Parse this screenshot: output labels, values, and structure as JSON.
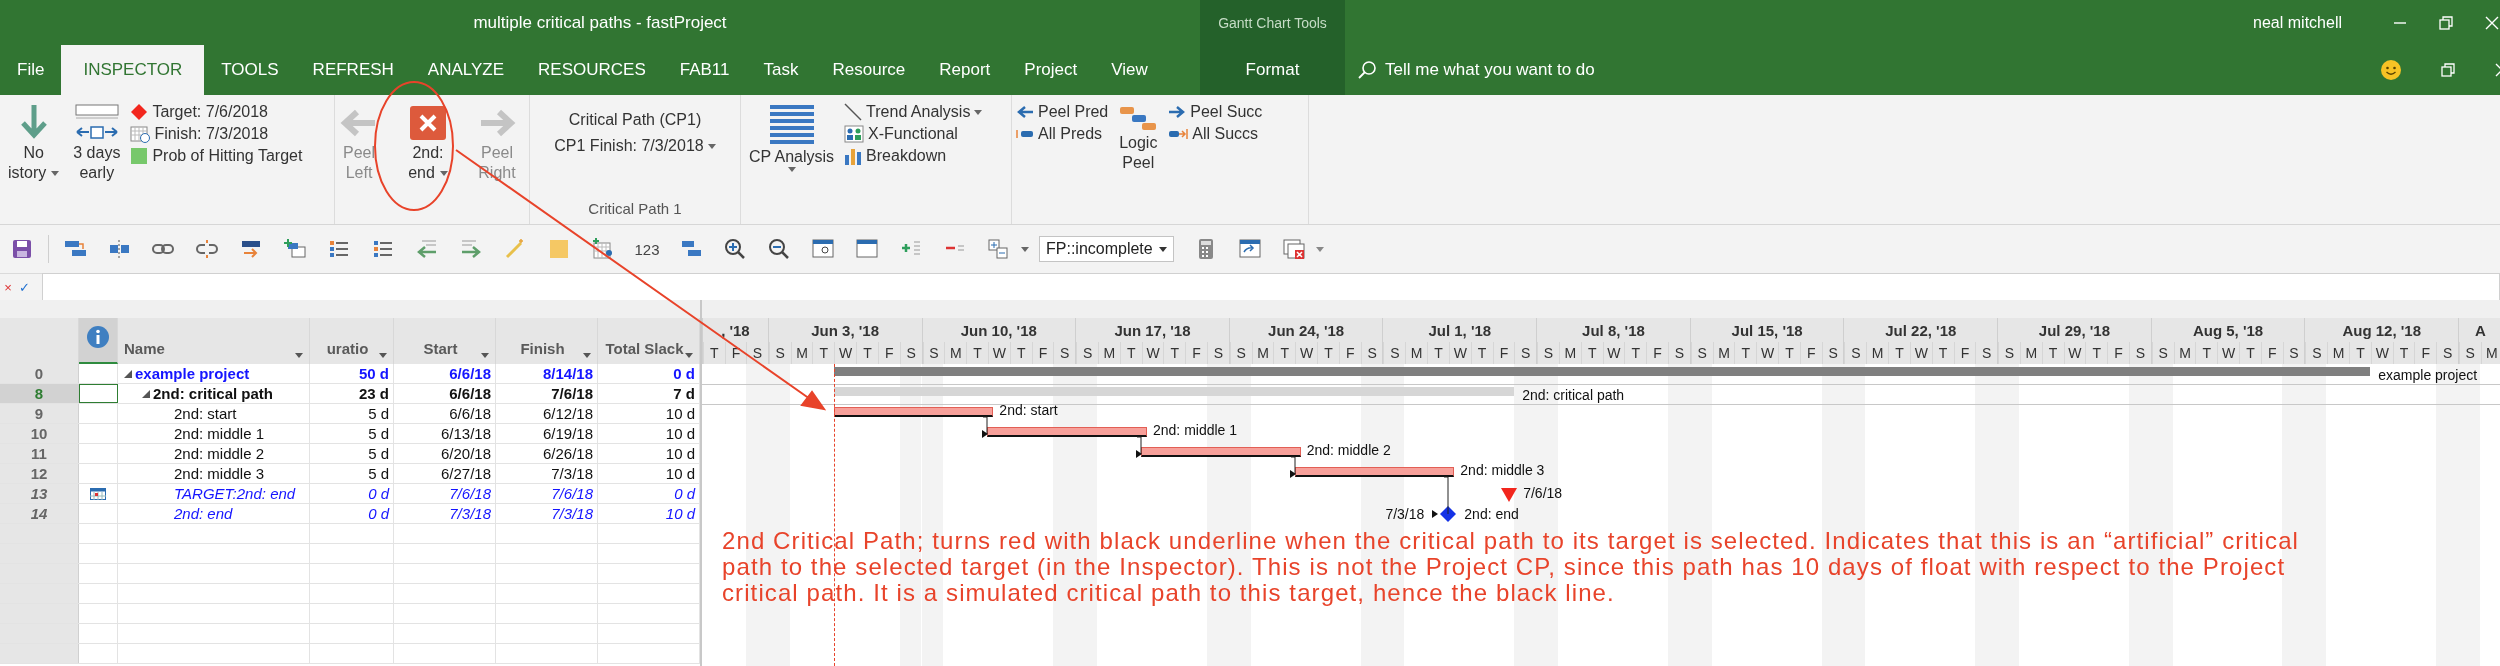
{
  "window": {
    "title": "multiple critical paths  -  fastProject",
    "context_group": "Gantt Chart Tools",
    "user": "neal mitchell"
  },
  "tabs": [
    {
      "label": "File",
      "kind": "standard",
      "selected": false
    },
    {
      "label": "INSPECTOR",
      "kind": "standard",
      "selected": true
    },
    {
      "label": "TOOLS",
      "kind": "standard",
      "selected": false
    },
    {
      "label": "REFRESH",
      "kind": "standard",
      "selected": false
    },
    {
      "label": "ANALYZE",
      "kind": "standard",
      "selected": false
    },
    {
      "label": "RESOURCES",
      "kind": "standard",
      "selected": false
    },
    {
      "label": "FAB11",
      "kind": "standard",
      "selected": false
    },
    {
      "label": "Task",
      "kind": "standard",
      "selected": false
    },
    {
      "label": "Resource",
      "kind": "standard",
      "selected": false
    },
    {
      "label": "Report",
      "kind": "standard",
      "selected": false
    },
    {
      "label": "Project",
      "kind": "standard",
      "selected": false
    },
    {
      "label": "View",
      "kind": "standard",
      "selected": false
    },
    {
      "label": "Format",
      "kind": "contextual",
      "selected": false
    }
  ],
  "tell_me": {
    "placeholder": "Tell me what you want to do"
  },
  "ribbon": {
    "history": {
      "lines": [
        "No",
        "istory"
      ]
    },
    "early": {
      "lines": [
        "3 days",
        "early"
      ]
    },
    "target_info": [
      {
        "kind": "target",
        "text": "Target: 7/6/2018"
      },
      {
        "kind": "finish",
        "text": "Finish: 7/3/2018"
      },
      {
        "kind": "probability",
        "text": "Prob of Hitting Target"
      }
    ],
    "peel_buttons": [
      {
        "kind": "left",
        "lines": [
          "Peel",
          "Left"
        ],
        "disabled": true
      },
      {
        "kind": "target",
        "lines": [
          "2nd:",
          "end"
        ],
        "disabled": false
      },
      {
        "kind": "right",
        "lines": [
          "Peel",
          "Right"
        ],
        "disabled": true
      }
    ],
    "critical_path": {
      "title": "Critical Path (CP1)",
      "finish": "CP1 Finish: 7/3/2018",
      "group_label": "Critical Path 1"
    },
    "cp_analysis": {
      "label": "CP Analysis"
    },
    "analysis_items": [
      {
        "kind": "trend",
        "label": "Trend Analysis",
        "dropdown": true
      },
      {
        "kind": "functional",
        "label": "X-Functional",
        "dropdown": false
      },
      {
        "kind": "breakdown",
        "label": "Breakdown",
        "dropdown": false
      }
    ],
    "peel_pred": [
      {
        "kind": "peel",
        "label": "Peel Pred"
      },
      {
        "kind": "all",
        "label": "All Preds"
      }
    ],
    "logic_peel": {
      "lines": [
        "Logic",
        "Peel"
      ]
    },
    "peel_succ": [
      {
        "kind": "peel",
        "label": "Peel Succ"
      },
      {
        "kind": "all",
        "label": "All Succs"
      }
    ]
  },
  "toolbar": {
    "number_label": "123",
    "filter": "FP::incomplete"
  },
  "formula_bar": {
    "cancel": "×",
    "enter": "✓"
  },
  "table": {
    "columns": [
      {
        "label": "Name"
      },
      {
        "label": "uratio"
      },
      {
        "label": "Start"
      },
      {
        "label": "Finish"
      },
      {
        "label": "Total Slack"
      }
    ],
    "rows": [
      {
        "id": "0",
        "name": "example project",
        "duration": "50 d",
        "start": "6/6/18",
        "finish": "8/14/18",
        "slack": "0 d",
        "kind": "project",
        "selected": false,
        "expanded": true,
        "bar": {
          "kind": "project_summary",
          "label": "example project"
        },
        "children": [
          {
            "id": "8",
            "name": "2nd: critical path",
            "duration": "23 d",
            "start": "6/6/18",
            "finish": "7/6/18",
            "slack": "7 d",
            "kind": "summary",
            "selected": true,
            "expanded": true,
            "bar": {
              "kind": "summary",
              "label": "2nd: critical path"
            },
            "children": [
              {
                "id": "9",
                "name": "2nd: start",
                "duration": "5 d",
                "start": "6/6/18",
                "finish": "6/12/18",
                "slack": "10 d",
                "kind": "task",
                "selected": false,
                "expanded": false,
                "bar": {
                  "kind": "critical_task",
                  "label": "2nd: start"
                }
              },
              {
                "id": "10",
                "name": "2nd: middle 1",
                "duration": "5 d",
                "start": "6/13/18",
                "finish": "6/19/18",
                "slack": "10 d",
                "kind": "task",
                "selected": false,
                "expanded": false,
                "bar": {
                  "kind": "critical_task",
                  "label": "2nd: middle 1"
                }
              },
              {
                "id": "11",
                "name": "2nd: middle 2",
                "duration": "5 d",
                "start": "6/20/18",
                "finish": "6/26/18",
                "slack": "10 d",
                "kind": "task",
                "selected": false,
                "expanded": false,
                "bar": {
                  "kind": "critical_task",
                  "label": "2nd: middle 2"
                }
              },
              {
                "id": "12",
                "name": "2nd: middle 3",
                "duration": "5 d",
                "start": "6/27/18",
                "finish": "7/3/18",
                "slack": "10 d",
                "kind": "task",
                "selected": false,
                "expanded": false,
                "bar": {
                  "kind": "critical_task",
                  "label": "2nd: middle 3"
                }
              },
              {
                "id": "13",
                "name": "TARGET:2nd: end",
                "duration": "0 d",
                "start": "7/6/18",
                "finish": "7/6/18",
                "slack": "0 d",
                "kind": "target",
                "selected": false,
                "expanded": false,
                "bar": {
                  "kind": "target",
                  "label": "7/6/18"
                }
              },
              {
                "id": "14",
                "name": "2nd: end",
                "duration": "0 d",
                "start": "7/3/18",
                "finish": "7/3/18",
                "slack": "10 d",
                "kind": "milestone",
                "selected": false,
                "expanded": false,
                "bar": {
                  "kind": "milestone",
                  "date_label": "7/3/18",
                  "label": "2nd: end"
                }
              }
            ]
          }
        ]
      }
    ]
  },
  "timescale": {
    "weeks": [
      {
        "label": ", '18",
        "days": [
          "T",
          "F",
          "S"
        ]
      },
      {
        "label": "Jun 3, '18",
        "days": [
          "S",
          "M",
          "T",
          "W",
          "T",
          "F",
          "S"
        ]
      },
      {
        "label": "Jun 10, '18",
        "days": [
          "S",
          "M",
          "T",
          "W",
          "T",
          "F",
          "S"
        ]
      },
      {
        "label": "Jun 17, '18",
        "days": [
          "S",
          "M",
          "T",
          "W",
          "T",
          "F",
          "S"
        ]
      },
      {
        "label": "Jun 24, '18",
        "days": [
          "S",
          "M",
          "T",
          "W",
          "T",
          "F",
          "S"
        ]
      },
      {
        "label": "Jul 1, '18",
        "days": [
          "S",
          "M",
          "T",
          "W",
          "T",
          "F",
          "S"
        ]
      },
      {
        "label": "Jul 8, '18",
        "days": [
          "S",
          "M",
          "T",
          "W",
          "T",
          "F",
          "S"
        ]
      },
      {
        "label": "Jul 15, '18",
        "days": [
          "S",
          "M",
          "T",
          "W",
          "T",
          "F",
          "S"
        ]
      },
      {
        "label": "Jul 22, '18",
        "days": [
          "S",
          "M",
          "T",
          "W",
          "T",
          "F",
          "S"
        ]
      },
      {
        "label": "Jul 29, '18",
        "days": [
          "S",
          "M",
          "T",
          "W",
          "T",
          "F",
          "S"
        ]
      },
      {
        "label": "Aug 5, '18",
        "days": [
          "S",
          "M",
          "T",
          "W",
          "T",
          "F",
          "S"
        ]
      },
      {
        "label": "Aug 12, '18",
        "days": [
          "S",
          "M",
          "T",
          "W",
          "T",
          "F",
          "S"
        ]
      },
      {
        "label": "A",
        "days": [
          "S",
          "M"
        ]
      }
    ]
  },
  "annotation": {
    "text": "2nd Critical Path; turns red with black underline when the critical path to its target is selected. Indicates that this is an “artificial” critical path to the selected target (in the Inspector). This is not the Project CP, since this path has 10 days of float with respect to the Project critical path. It is a simulated critical path to this target, hence the black line."
  }
}
